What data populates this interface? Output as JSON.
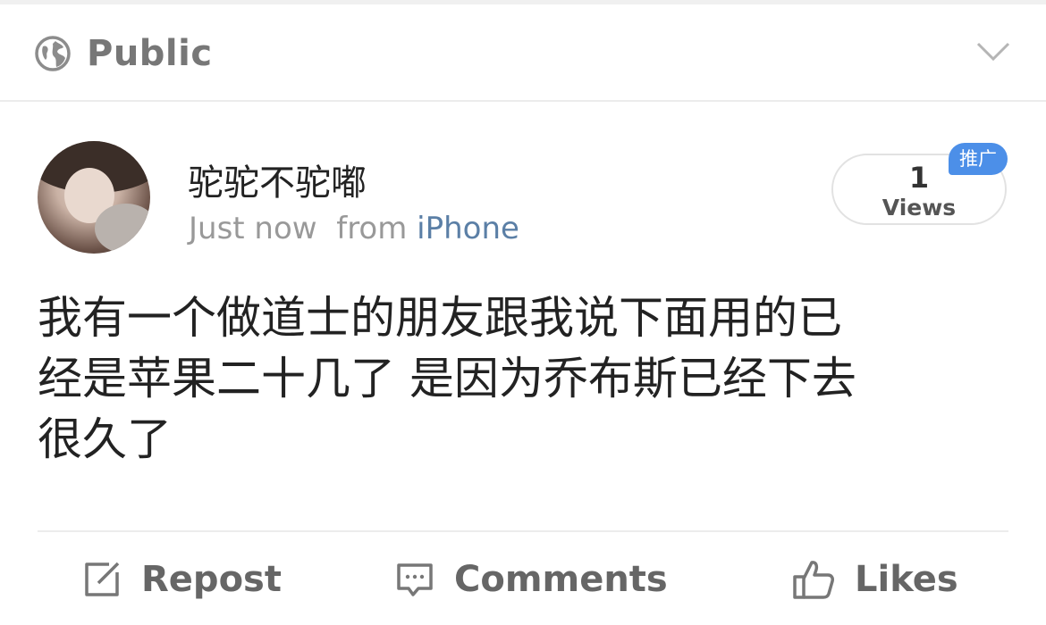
{
  "visibility": {
    "icon": "globe-icon",
    "label": "Public",
    "dropdown_icon": "chevron-down-icon"
  },
  "post": {
    "author": "驼驼不驼嘟",
    "time": "Just now",
    "source_prefix": "from",
    "source": "iPhone",
    "views": {
      "count": "1",
      "label": "Views"
    },
    "badge": "推广",
    "text_lines": [
      "我有一个做道士的朋友跟我说下面用的已",
      "经是苹果二十几了 是因为乔布斯已经下去",
      "很久了"
    ]
  },
  "actions": {
    "repost": {
      "icon": "edit-icon",
      "label": "Repost"
    },
    "comments": {
      "icon": "comment-icon",
      "label": "Comments"
    },
    "likes": {
      "icon": "thumbs-up-icon",
      "label": "Likes"
    }
  },
  "colors": {
    "link_blue": "#5b7fa6",
    "badge_blue": "#4c8fe8",
    "muted_text": "#999999"
  }
}
